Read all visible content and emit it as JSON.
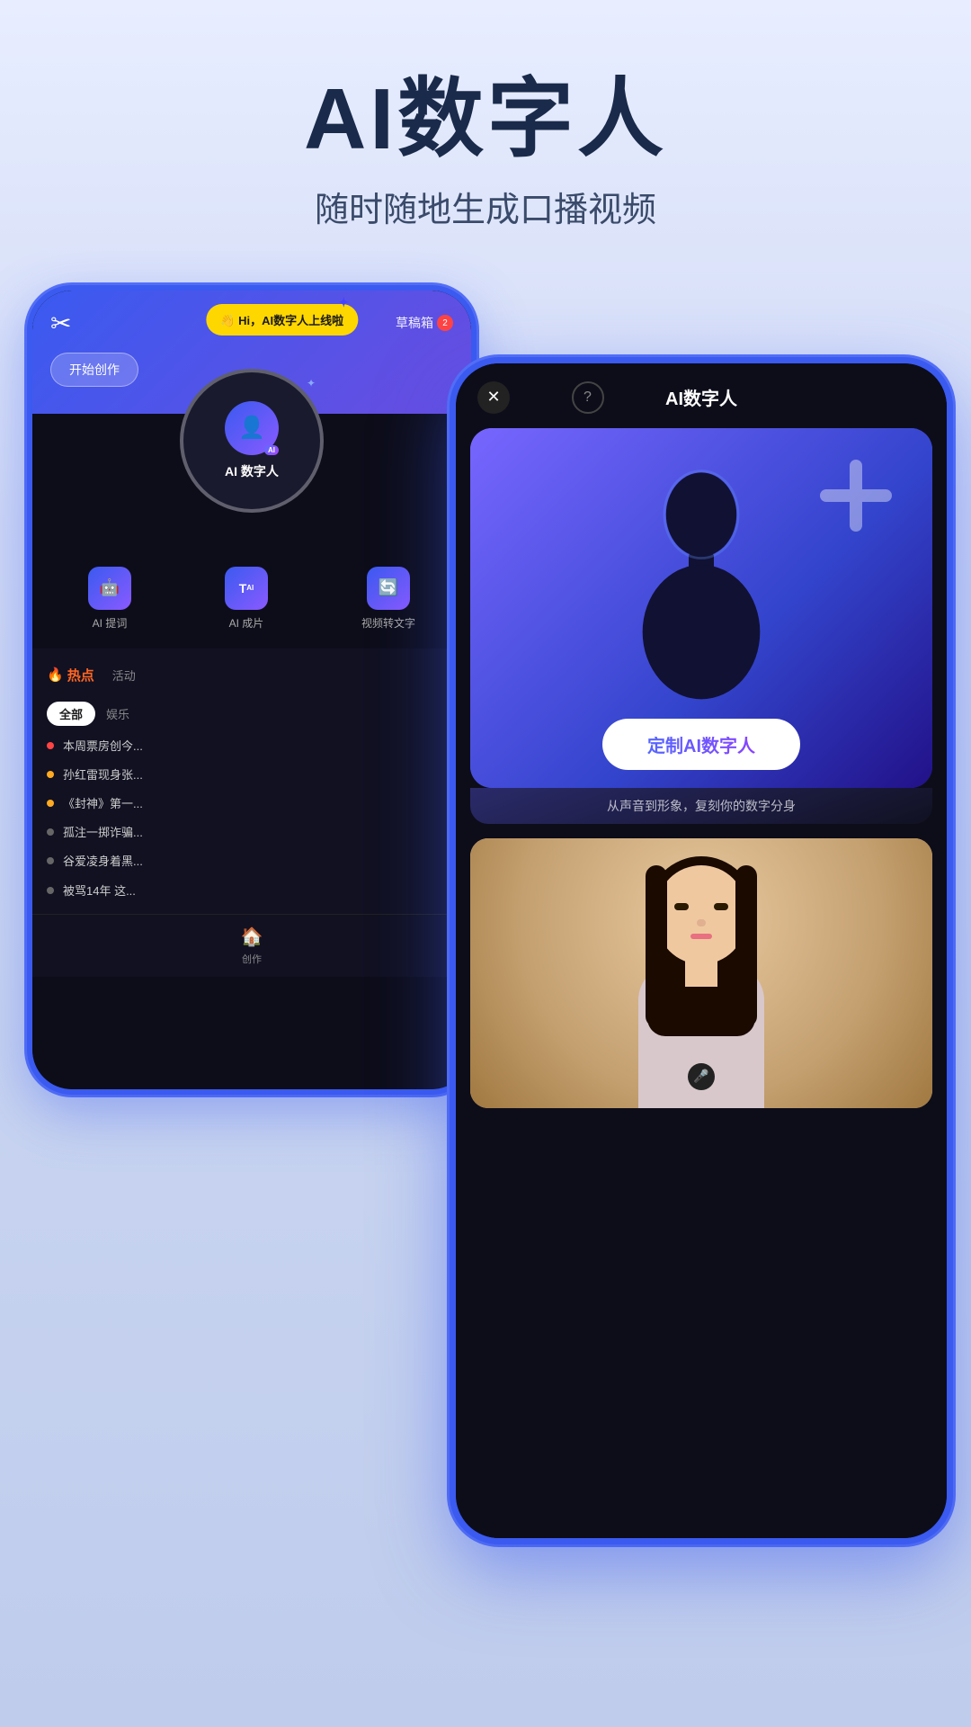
{
  "header": {
    "title": "AI数字人",
    "subtitle": "随时随地生成口播视频"
  },
  "back_phone": {
    "scissors_icon": "✂",
    "ai_popup": "👋 Hi，AI数字人上线啦",
    "ai_circle_label": "AI 数字人",
    "draft_label": "草稿箱",
    "draft_count": "2",
    "start_create_label": "开始创作",
    "tools": [
      {
        "label": "AI 提词",
        "icon": "🤖"
      },
      {
        "label": "AI 成片",
        "icon": "T"
      },
      {
        "label": "视频转文字",
        "icon": "🔄"
      }
    ],
    "hot_label": "热点",
    "activity_label": "活动",
    "filter_all": "全部",
    "filter_entertainment": "娱乐",
    "news": [
      {
        "text": "本周票房创今...",
        "dot_color": "#ff4444"
      },
      {
        "text": "孙红雷现身张...",
        "dot_color": "#ffaa22"
      },
      {
        "text": "《封神》第一...",
        "dot_color": "#ffaa22"
      },
      {
        "text": "孤注一掷诈骗...",
        "dot_color": "#888888"
      },
      {
        "text": "谷爱凌身着黑...",
        "dot_color": "#888888"
      },
      {
        "text": "被骂14年 这...",
        "dot_color": "#888888"
      }
    ],
    "nav_label": "创作",
    "nav_icon": "🏠"
  },
  "front_phone": {
    "title": "AI数字人",
    "close_icon": "✕",
    "help_icon": "?",
    "customize_btn_label": "定制AI数字人",
    "customize_subtitle": "从声音到形象，复刻你的数字分身",
    "sparkle": "✦"
  }
}
